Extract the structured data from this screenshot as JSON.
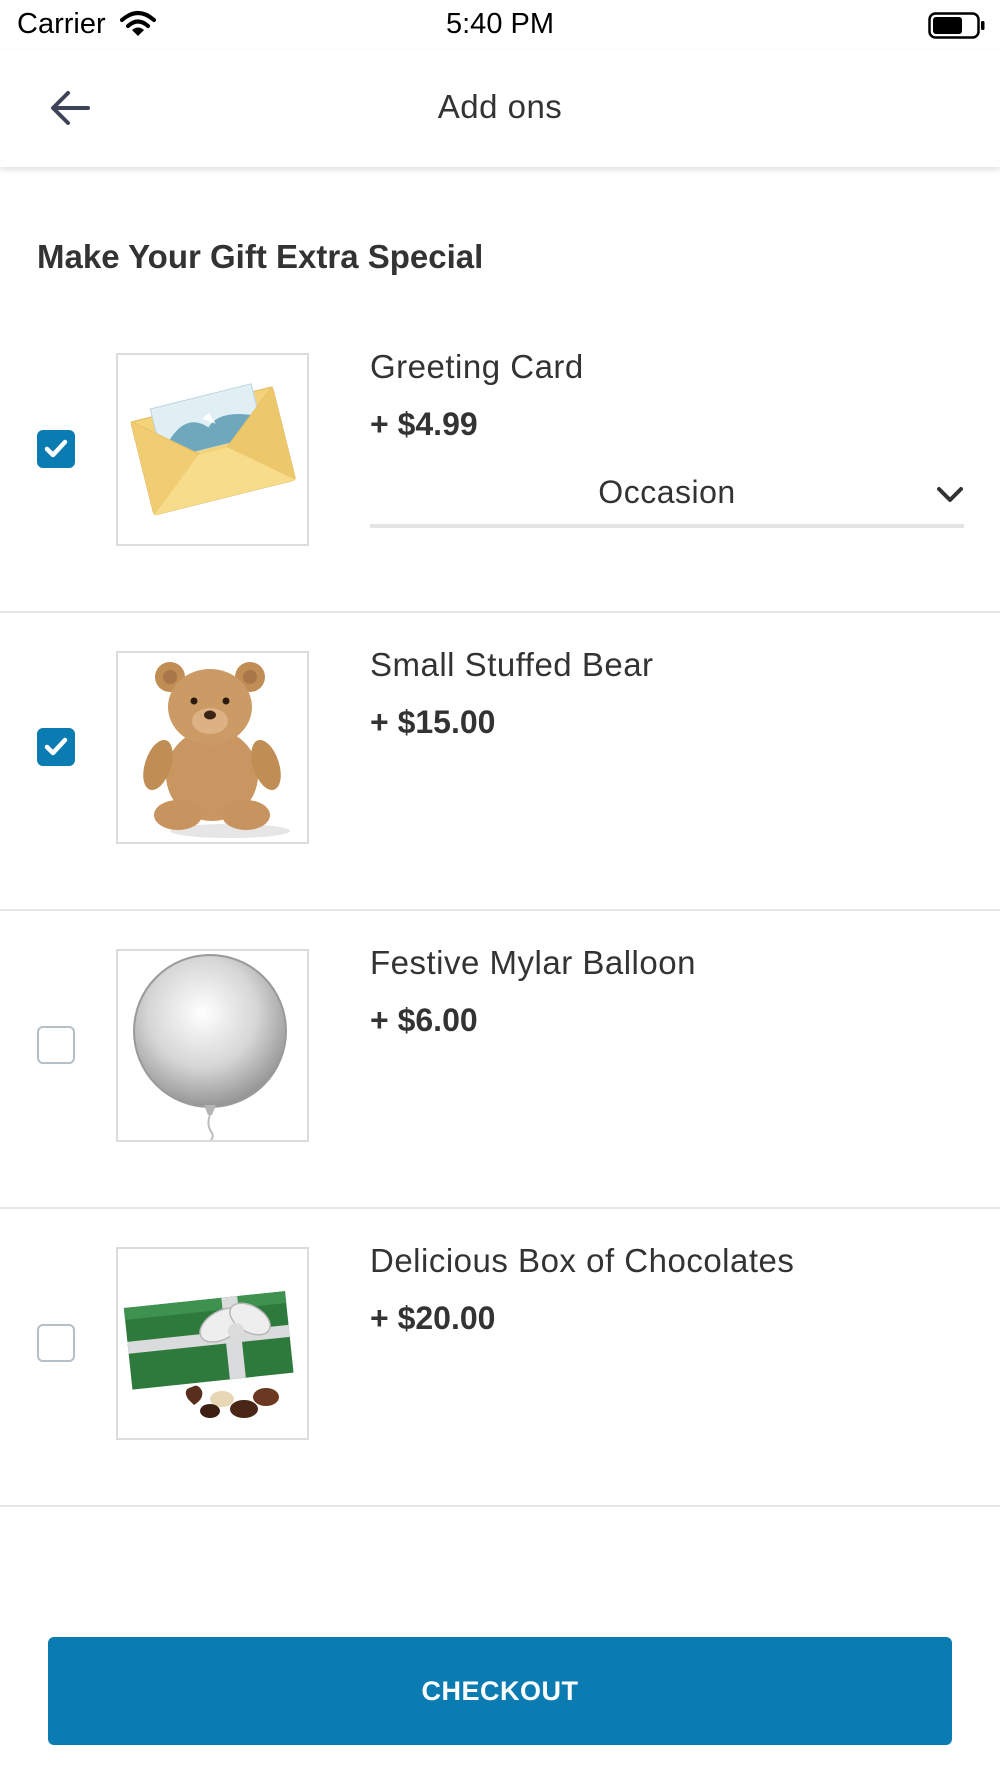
{
  "status_bar": {
    "carrier": "Carrier",
    "time": "5:40 PM"
  },
  "header": {
    "title": "Add ons"
  },
  "section": {
    "heading": "Make Your Gift Extra Special"
  },
  "addons": [
    {
      "name": "Greeting Card",
      "price": "+ $4.99",
      "checked": true,
      "select_label": "Occasion",
      "image": "greeting-card-envelope"
    },
    {
      "name": "Small Stuffed Bear",
      "price": "+ $15.00",
      "checked": true,
      "image": "teddy-bear"
    },
    {
      "name": "Festive Mylar Balloon",
      "price": "+ $6.00",
      "checked": false,
      "image": "silver-balloon"
    },
    {
      "name": "Delicious Box of Chocolates",
      "price": "+ $20.00",
      "checked": false,
      "image": "chocolate-box"
    }
  ],
  "checkout": {
    "label": "CHECKOUT"
  },
  "colors": {
    "accent": "#0a7cb1",
    "divider": "#e6e6e6",
    "text": "#333333"
  }
}
